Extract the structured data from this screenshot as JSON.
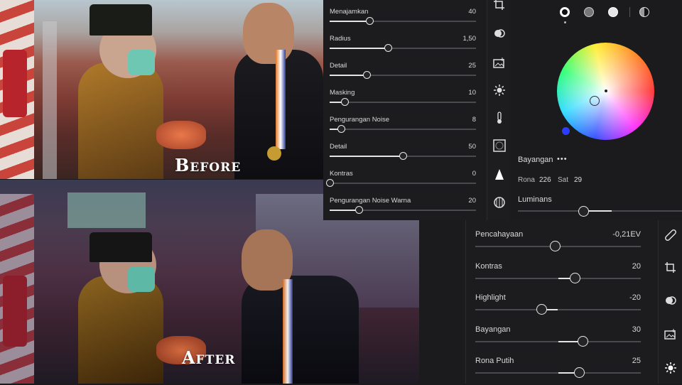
{
  "photos": {
    "before_label": "Before",
    "after_label": "After"
  },
  "detail_panel": {
    "sliders": [
      {
        "label": "Menajamkan",
        "value": "40",
        "level": 0.27
      },
      {
        "label": "Radius",
        "value": "1,50",
        "level": 0.4
      },
      {
        "label": "Detail",
        "value": "25",
        "level": 0.25
      },
      {
        "label": "Masking",
        "value": "10",
        "level": 0.1
      },
      {
        "label": "Pengurangan Noise",
        "value": "8",
        "level": 0.08
      },
      {
        "label": "Detail",
        "value": "50",
        "level": 0.5
      },
      {
        "label": "Kontras",
        "value": "0",
        "level": 0.0
      },
      {
        "label": "Pengurangan Noise Warna",
        "value": "20",
        "level": 0.2
      }
    ]
  },
  "tools_top": [
    "crop-icon",
    "healing-icon",
    "presets-icon",
    "light-icon",
    "temperature-icon",
    "vignette-icon",
    "sharpen-icon",
    "optics-icon"
  ],
  "color_panel": {
    "swatches": [
      "all-swatch",
      "shadows-swatch",
      "highlights-swatch",
      "split-swatch"
    ],
    "section_label": "Bayangan",
    "more_label": "•••",
    "hue_label": "Rona",
    "hue_value": "226",
    "sat_label": "Sat",
    "sat_value": "29",
    "luminance_label": "Luminans",
    "luminance_level": 0.4
  },
  "basic_panel": {
    "sliders": [
      {
        "label": "Pencahayaan",
        "value": "-0,21EV",
        "level": 0.48
      },
      {
        "label": "Kontras",
        "value": "20",
        "level": 0.6
      },
      {
        "label": "Highlight",
        "value": "-20",
        "level": 0.4
      },
      {
        "label": "Bayangan",
        "value": "30",
        "level": 0.65
      },
      {
        "label": "Rona Putih",
        "value": "25",
        "level": 0.625
      }
    ]
  },
  "tools_bottom": [
    "healing-icon",
    "crop-icon",
    "mask-icon",
    "presets-icon",
    "light-icon"
  ],
  "colors": {
    "accent": "#e8e8e8",
    "panel_bg": "#1c1c1e",
    "hue_dot": "#2a3cff"
  }
}
